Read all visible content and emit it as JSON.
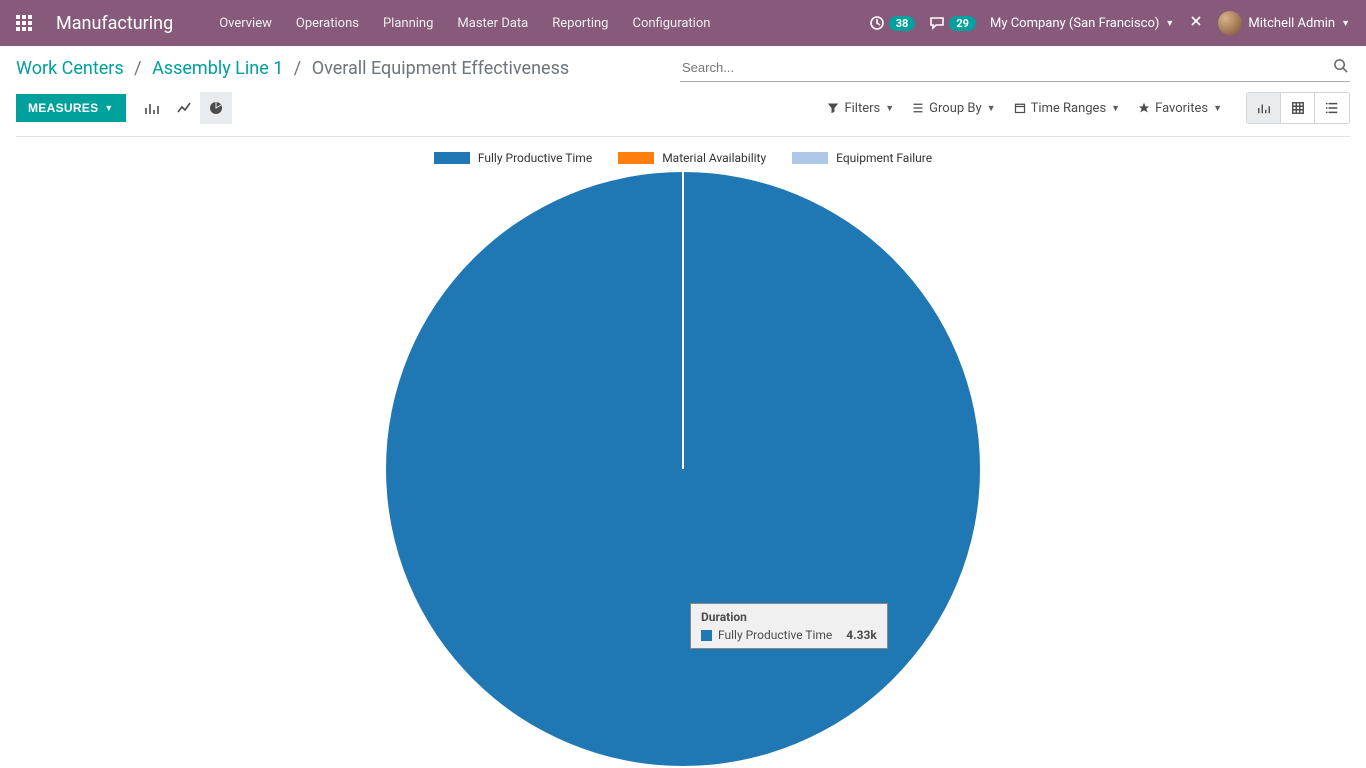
{
  "brand": {
    "app_title": "Manufacturing"
  },
  "nav": {
    "items": [
      "Overview",
      "Operations",
      "Planning",
      "Master Data",
      "Reporting",
      "Configuration"
    ]
  },
  "systray": {
    "activities_count": "38",
    "messages_count": "29",
    "company": "My Company (San Francisco)",
    "user": "Mitchell Admin"
  },
  "breadcrumb": {
    "items": [
      {
        "label": "Work Centers",
        "link": true
      },
      {
        "label": "Assembly Line 1",
        "link": true
      },
      {
        "label": "Overall Equipment Effectiveness",
        "link": false
      }
    ]
  },
  "search": {
    "placeholder": "Search..."
  },
  "toolbar": {
    "measures_label": "MEASURES",
    "filters": "Filters",
    "group_by": "Group By",
    "time_ranges": "Time Ranges",
    "favorites": "Favorites"
  },
  "legend": [
    {
      "label": "Fully Productive Time",
      "color": "#1f77b4"
    },
    {
      "label": "Material Availability",
      "color": "#ff7f0e"
    },
    {
      "label": "Equipment Failure",
      "color": "#aec7e8"
    }
  ],
  "tooltip": {
    "title": "Duration",
    "series_label": "Fully Productive Time",
    "series_color": "#1f77b4",
    "series_value": "4.33k"
  },
  "chart_data": {
    "type": "pie",
    "title": "Overall Equipment Effectiveness",
    "measure": "Duration",
    "series": [
      {
        "name": "Fully Productive Time",
        "value": 4330,
        "display": "4.33k",
        "color": "#1f77b4"
      },
      {
        "name": "Material Availability",
        "value": 0,
        "color": "#ff7f0e"
      },
      {
        "name": "Equipment Failure",
        "value": 0,
        "color": "#aec7e8"
      }
    ]
  },
  "colors": {
    "primary": "#00a09d",
    "navbar": "#875a7b",
    "pie": "#1f77b4"
  }
}
